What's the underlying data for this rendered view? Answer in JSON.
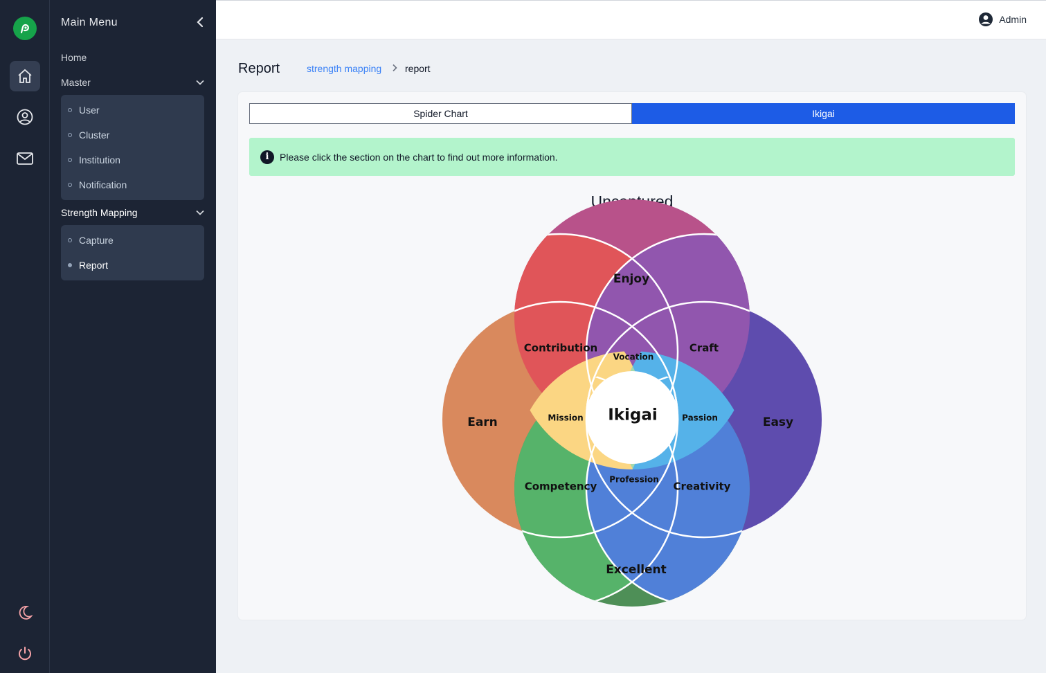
{
  "rail": {
    "icons": [
      "logo-icon",
      "home-icon",
      "user-circle-icon",
      "mail-icon",
      "moon-icon",
      "power-icon"
    ]
  },
  "menu": {
    "title": "Main Menu",
    "home": "Home",
    "master": {
      "label": "Master",
      "items": [
        "User",
        "Cluster",
        "Institution",
        "Notification"
      ]
    },
    "strength": {
      "label": "Strength Mapping",
      "items": [
        "Capture",
        "Report"
      ],
      "active": "Report"
    }
  },
  "topbar": {
    "user": "Admin"
  },
  "page": {
    "title": "Report",
    "breadcrumb": {
      "link": "strength mapping",
      "current": "report"
    }
  },
  "tabs": {
    "spider": "Spider Chart",
    "ikigai": "Ikigai",
    "active": "Ikigai"
  },
  "alert": {
    "text": "Please click the section on the chart to find out more information."
  },
  "chart": {
    "title": "Uncaptured",
    "labels": {
      "enjoy": "Enjoy",
      "earn": "Earn",
      "easy": "Easy",
      "excellent": "Excellent",
      "contribution": "Contribution",
      "craft": "Craft",
      "competency": "Competency",
      "creativity": "Creativity",
      "vocation": "Vocation",
      "mission": "Mission",
      "passion": "Passion",
      "profession": "Profession",
      "center": "Ikigai"
    },
    "colors": {
      "enjoy": "#b8528a",
      "earn": "#d9895d",
      "easy": "#5e4cae",
      "excellent": "#4e8f57",
      "contribution": "#e05559",
      "craft": "#9156ae",
      "competency": "#56b36a",
      "creativity": "#5080d8",
      "vocation": "#f7a2d2",
      "mission": "#fbd683",
      "passion": "#55b2e9",
      "profession": "#a3d9ae",
      "center": "#ffffff",
      "accent": "#1d5ce6",
      "alert_bg": "#b3f4cc"
    }
  }
}
